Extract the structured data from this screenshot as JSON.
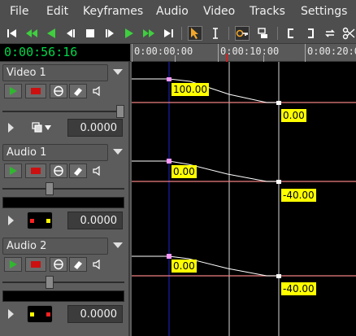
{
  "menu": [
    "File",
    "Edit",
    "Keyframes",
    "Audio",
    "Video",
    "Tracks",
    "Settings"
  ],
  "toolbar": {
    "transport_icons": [
      "skip-to-start-icon",
      "rewind-icon",
      "play-backward-icon",
      "step-back-icon",
      "stop-icon",
      "step-forward-icon",
      "play-icon",
      "fast-forward-icon",
      "skip-to-end-icon"
    ],
    "tool_icons": [
      "select-arrow-icon",
      "text-cursor-icon",
      "key-icon",
      "razor-tool-icon",
      "bracket-left-icon",
      "bracket-right-icon",
      "loop-icon",
      "scissors-icon"
    ]
  },
  "timecode": "0:00:56:16",
  "ruler": {
    "labels": [
      "0:00:00:00",
      "0:00:10:00",
      "0:00:20:0"
    ]
  },
  "tracks": [
    {
      "name": "Video 1",
      "type": "video",
      "value": "0.0000",
      "keyframe_labels": [
        "100.00",
        "0.00"
      ]
    },
    {
      "name": "Audio 1",
      "type": "audio",
      "value": "0.0000",
      "keyframe_labels": [
        "0.00",
        "-40.00"
      ]
    },
    {
      "name": "Audio 2",
      "type": "audio",
      "value": "0.0000",
      "keyframe_labels": [
        "0.00",
        "-40.00"
      ]
    }
  ],
  "colors": {
    "timecode_text": "#00d84a",
    "keyframe_label_bg": "#ffff00",
    "track_line": "#f08080",
    "playhead_marker": "#d42020",
    "cursor_line": "#2020d0",
    "play_button": "#2fb82f",
    "record_button": "#cc1010"
  }
}
